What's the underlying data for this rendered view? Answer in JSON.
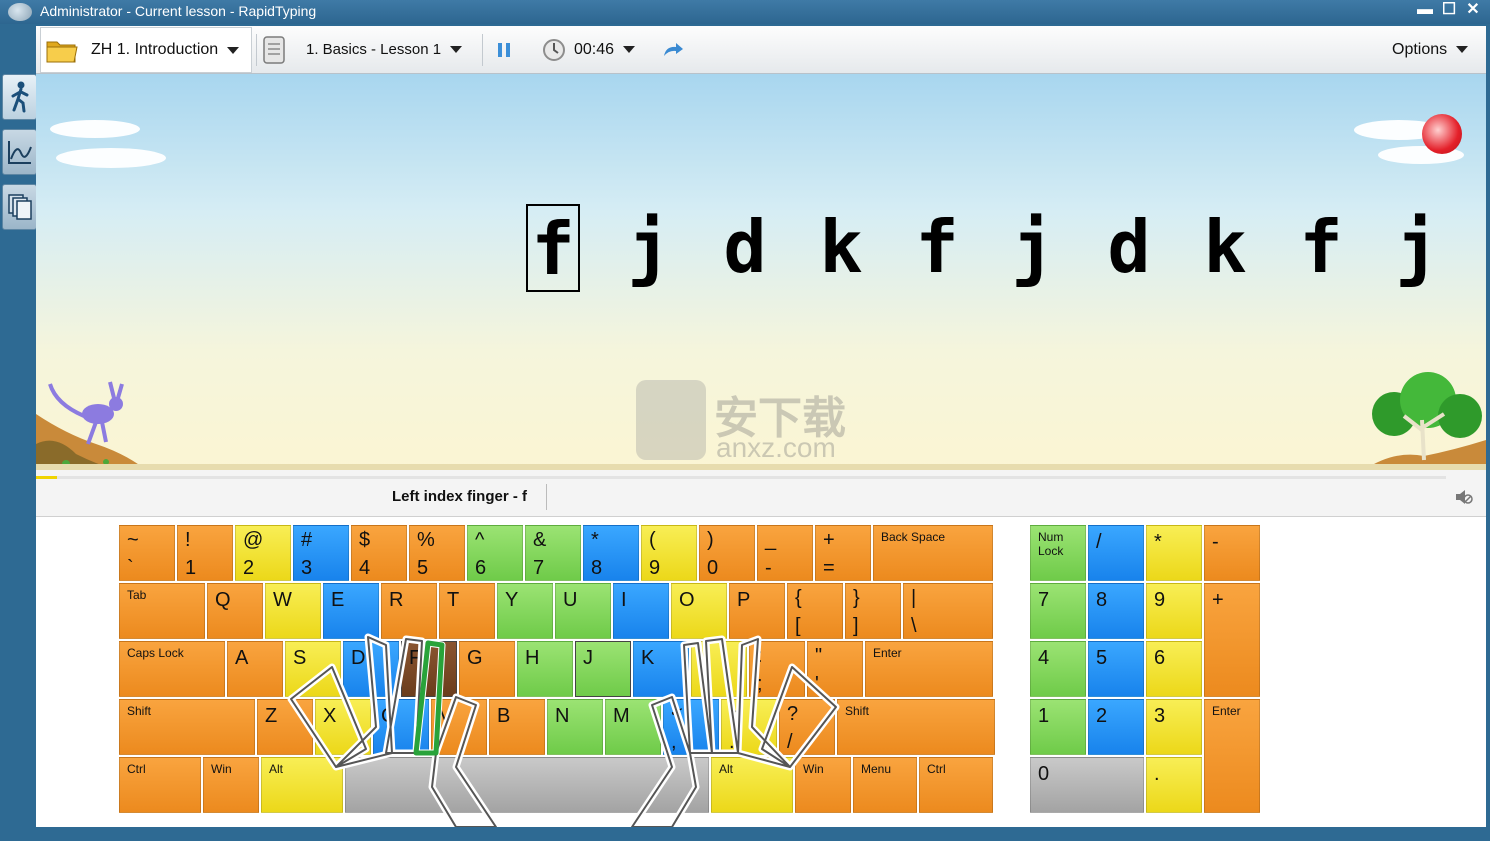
{
  "window": {
    "title": "Administrator - Current lesson - RapidTyping",
    "buttons": [
      "minimize",
      "maximize",
      "close"
    ]
  },
  "sidebar": {
    "tabs": [
      {
        "icon": "walking-person-icon",
        "active": true
      },
      {
        "icon": "statistics-chart-icon",
        "active": false
      },
      {
        "icon": "lessons-pages-icon",
        "active": false
      }
    ]
  },
  "toolbar": {
    "course": "ZH 1. Introduction",
    "lesson": "1. Basics - Lesson 1",
    "timer": "00:46",
    "options": "Options"
  },
  "lesson": {
    "characters": [
      "f",
      "j",
      "d",
      "k",
      "f",
      "j",
      "d",
      "k",
      "f",
      "j"
    ],
    "current_index": 0,
    "progress_fraction": 0.015
  },
  "status": {
    "hint": "Left index finger - f"
  },
  "watermark": {
    "text": "安下载",
    "subtext": "anxz.com"
  },
  "keyboard": {
    "main_rows": [
      [
        {
          "top": "~",
          "bottom": "`",
          "color": "o"
        },
        {
          "top": "!",
          "bottom": "1",
          "color": "o"
        },
        {
          "top": "@",
          "bottom": "2",
          "color": "y"
        },
        {
          "top": "#",
          "bottom": "3",
          "color": "bl"
        },
        {
          "top": "$",
          "bottom": "4",
          "color": "o"
        },
        {
          "top": "%",
          "bottom": "5",
          "color": "o"
        },
        {
          "top": "^",
          "bottom": "6",
          "color": "g"
        },
        {
          "top": "&",
          "bottom": "7",
          "color": "g"
        },
        {
          "top": "*",
          "bottom": "8",
          "color": "bl"
        },
        {
          "top": "(",
          "bottom": "9",
          "color": "y"
        },
        {
          "top": ")",
          "bottom": "0",
          "color": "o"
        },
        {
          "top": "_",
          "bottom": "-",
          "color": "o"
        },
        {
          "top": "+",
          "bottom": "=",
          "color": "o"
        },
        {
          "label": "Back Space",
          "color": "o"
        }
      ],
      [
        {
          "label": "Tab",
          "color": "o"
        },
        {
          "letter": "Q",
          "color": "o"
        },
        {
          "letter": "W",
          "color": "y"
        },
        {
          "letter": "E",
          "color": "bl"
        },
        {
          "letter": "R",
          "color": "o"
        },
        {
          "letter": "T",
          "color": "o"
        },
        {
          "letter": "Y",
          "color": "g"
        },
        {
          "letter": "U",
          "color": "g"
        },
        {
          "letter": "I",
          "color": "bl"
        },
        {
          "letter": "O",
          "color": "y"
        },
        {
          "letter": "P",
          "color": "o"
        },
        {
          "top": "{",
          "bottom": "[",
          "color": "o"
        },
        {
          "top": "}",
          "bottom": "]",
          "color": "o"
        },
        {
          "top": "|",
          "bottom": "\\",
          "color": "o"
        }
      ],
      [
        {
          "label": "Caps Lock",
          "color": "o"
        },
        {
          "letter": "A",
          "color": "o"
        },
        {
          "letter": "S",
          "color": "y"
        },
        {
          "letter": "D",
          "color": "bl"
        },
        {
          "letter": "F",
          "color": "br"
        },
        {
          "letter": "G",
          "color": "o"
        },
        {
          "letter": "H",
          "color": "g"
        },
        {
          "letter": "J",
          "color": "g"
        },
        {
          "letter": "K",
          "color": "bl"
        },
        {
          "letter": "L",
          "color": "y"
        },
        {
          "top": ":",
          "bottom": ";",
          "color": "o"
        },
        {
          "top": "\"",
          "bottom": "'",
          "color": "o"
        },
        {
          "label": "Enter",
          "color": "o"
        }
      ],
      [
        {
          "label": "Shift",
          "color": "o"
        },
        {
          "letter": "Z",
          "color": "o"
        },
        {
          "letter": "X",
          "color": "y"
        },
        {
          "letter": "C",
          "color": "bl"
        },
        {
          "letter": "V",
          "color": "o"
        },
        {
          "letter": "B",
          "color": "o"
        },
        {
          "letter": "N",
          "color": "g"
        },
        {
          "letter": "M",
          "color": "g"
        },
        {
          "top": "<",
          "bottom": ",",
          "color": "bl"
        },
        {
          "top": ">",
          "bottom": ".",
          "color": "y"
        },
        {
          "top": "?",
          "bottom": "/",
          "color": "o"
        },
        {
          "label": "Shift",
          "color": "o"
        }
      ],
      [
        {
          "label": "Ctrl",
          "color": "o"
        },
        {
          "label": "Win",
          "color": "o"
        },
        {
          "label": "Alt",
          "color": "y"
        },
        {
          "label": "",
          "color": "gr"
        },
        {
          "label": "Alt",
          "color": "y"
        },
        {
          "label": "Win",
          "color": "o"
        },
        {
          "label": "Menu",
          "color": "o"
        },
        {
          "label": "Ctrl",
          "color": "o"
        }
      ]
    ],
    "numpad": [
      {
        "label": "Num\nLock",
        "color": "g"
      },
      {
        "letter": "/",
        "color": "bl"
      },
      {
        "letter": "*",
        "color": "y"
      },
      {
        "letter": "-",
        "color": "o"
      },
      {
        "letter": "7",
        "color": "g"
      },
      {
        "letter": "8",
        "color": "bl"
      },
      {
        "letter": "9",
        "color": "y"
      },
      {
        "letter": "+",
        "color": "o"
      },
      {
        "letter": "4",
        "color": "g"
      },
      {
        "letter": "5",
        "color": "bl"
      },
      {
        "letter": "6",
        "color": "y"
      },
      {
        "letter": "1",
        "color": "g"
      },
      {
        "letter": "2",
        "color": "bl"
      },
      {
        "letter": "3",
        "color": "y"
      },
      {
        "label": "Enter",
        "color": "o"
      },
      {
        "letter": "0",
        "color": "gr"
      },
      {
        "letter": ".",
        "color": "y"
      }
    ]
  }
}
